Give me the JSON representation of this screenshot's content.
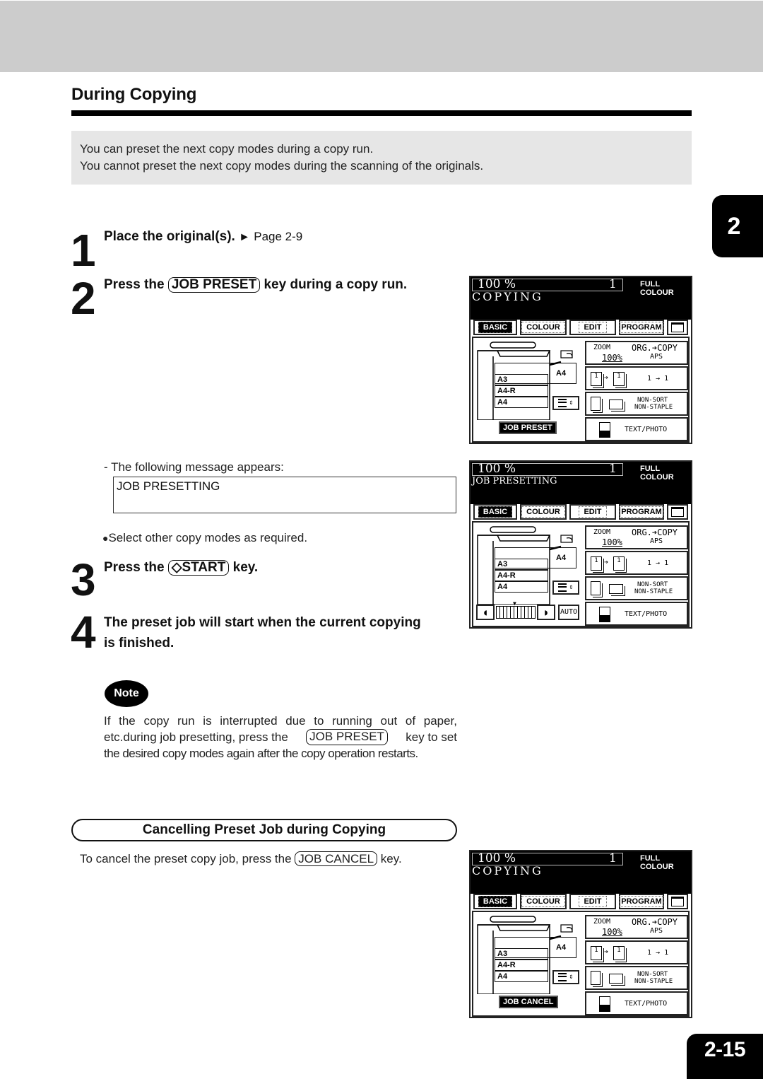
{
  "page": {
    "section_title": "During Copying",
    "intro": [
      "You can preset the next copy modes during a copy run.",
      "You cannot preset the next copy modes during the scanning of the originals."
    ],
    "chapter_tab": "2",
    "page_number": "2-15"
  },
  "steps": [
    {
      "num": "1",
      "text": "Place the original(s).",
      "ref_arrow": "►",
      "ref": "Page 2-9"
    },
    {
      "num": "2",
      "pre": "Press the",
      "key": "JOB PRESET",
      "post": "key during a copy run."
    },
    {
      "num": "3",
      "pre": "Press the",
      "key": "◇START",
      "post": "key."
    },
    {
      "num": "4",
      "line1": "The preset job will start when the current copying",
      "line2": "is finished."
    }
  ],
  "message_intro": "- The following message appears:",
  "message_box": "JOB PRESETTING",
  "bullet": {
    "symbol": "●",
    "text": "Select other copy modes as required."
  },
  "note": {
    "badge": "Note",
    "line1": "If the copy run is interrupted due to running out of paper,",
    "line2_pre": "etc.during job presetting, press the",
    "line2_key": "JOB PRESET",
    "line2_post": "key to set",
    "line3": "the desired copy modes again after the copy operation restarts."
  },
  "cancel_section": {
    "heading": "Cancelling Preset Job during Copying",
    "pre": "To cancel the preset copy job, press the",
    "key": "JOB CANCEL",
    "post": "key."
  },
  "lcd_common": {
    "zoom": "100  %",
    "count": "1",
    "mode": "FULL COLOUR",
    "tabs": [
      "BASIC",
      "COLOUR",
      "EDIT",
      "PROGRAM"
    ],
    "active_tab": "BASIC",
    "trays": {
      "right": "A4",
      "t1": "A3",
      "t2": "A4-R",
      "t3": "A4"
    },
    "zoom_btn": {
      "label": "ZOOM",
      "value": "100%",
      "org_copy": "ORG.➔COPY",
      "aps": "APS"
    },
    "duplex_btn": {
      "value": "1 → 1",
      "icon1": "1",
      "icon2": "1"
    },
    "finish_btn": {
      "line1": "NON-SORT",
      "line2": "NON-STAPLE"
    },
    "image_btn": {
      "label": "TEXT/PHOTO"
    },
    "auto": "AUTO"
  },
  "lcd_screens": [
    {
      "status": "COPYING",
      "bottom_button": "JOB PRESET"
    },
    {
      "status": "JOB PRESETTING",
      "bottom_button": "density-slider"
    },
    {
      "status": "COPYING",
      "bottom_button": "JOB CANCEL"
    }
  ]
}
